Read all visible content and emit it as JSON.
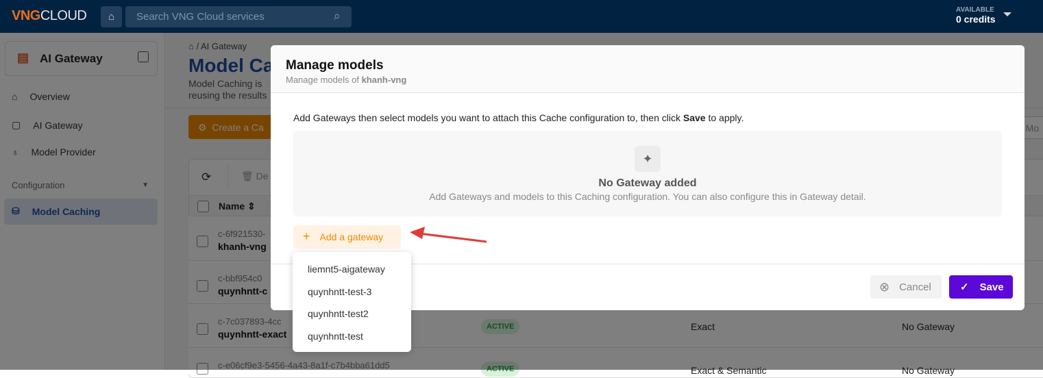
{
  "header": {
    "logo_a": "VNG",
    "logo_b": "CLOUD",
    "search_placeholder": "Search VNG Cloud services",
    "credits_label": "AVAILABLE",
    "credits_value": "0 credits"
  },
  "sidebar": {
    "product": "AI Gateway",
    "items": [
      {
        "label": "Overview",
        "icon": "home-icon"
      },
      {
        "label": "AI Gateway",
        "icon": "gateway-icon"
      },
      {
        "label": "Model Provider",
        "icon": "lightbulb-icon"
      }
    ],
    "section": "Configuration",
    "selected": "Model Caching"
  },
  "page": {
    "breadcrumb": [
      "AI Gateway"
    ],
    "title": "Model Ca",
    "desc1": "Model Caching is",
    "desc2": "reusing the results",
    "create_button": "Create a Ca",
    "search_partial": "n Mo",
    "delete_partial": "De",
    "name_header": "Name",
    "rows": [
      {
        "id": "c-6f921530-",
        "name": "khanh-vng"
      },
      {
        "id": "c-bbf954c0",
        "name": "quynhntt-c"
      },
      {
        "id": "c-7c037893-4cc",
        "name": "quynhntt-exact",
        "status": "ACTIVE",
        "type": "Exact",
        "gateway": "No Gateway"
      },
      {
        "id": "c-e06cf9e3-5456-4a43-8a1f-c7b4bba61dd5",
        "status": "ACTIVE",
        "type": "Exact & Semantic",
        "gateway": "No Gateway"
      }
    ]
  },
  "modal": {
    "title": "Manage models",
    "subtitle_prefix": "Manage models of ",
    "subtitle_name": "khanh-vng",
    "instruction_prefix": "Add Gateways then select models you want to attach this Cache configuration to, then click ",
    "instruction_bold": "Save",
    "instruction_suffix": " to apply.",
    "empty_title": "No Gateway added",
    "empty_desc": "Add Gateways and models to this Caching configuration. You can also configure this in Gateway detail.",
    "add_button": "Add a gateway",
    "cancel": "Cancel",
    "save": "Save",
    "dropdown": [
      "liemnt5-aigateway",
      "quynhntt-test-3",
      "quynhntt-test2",
      "quynhntt-test"
    ]
  },
  "colors": {
    "accent": "#5b08d9",
    "orange": "#f08a00",
    "header": "#012241",
    "arrow": "#e03b3b"
  }
}
